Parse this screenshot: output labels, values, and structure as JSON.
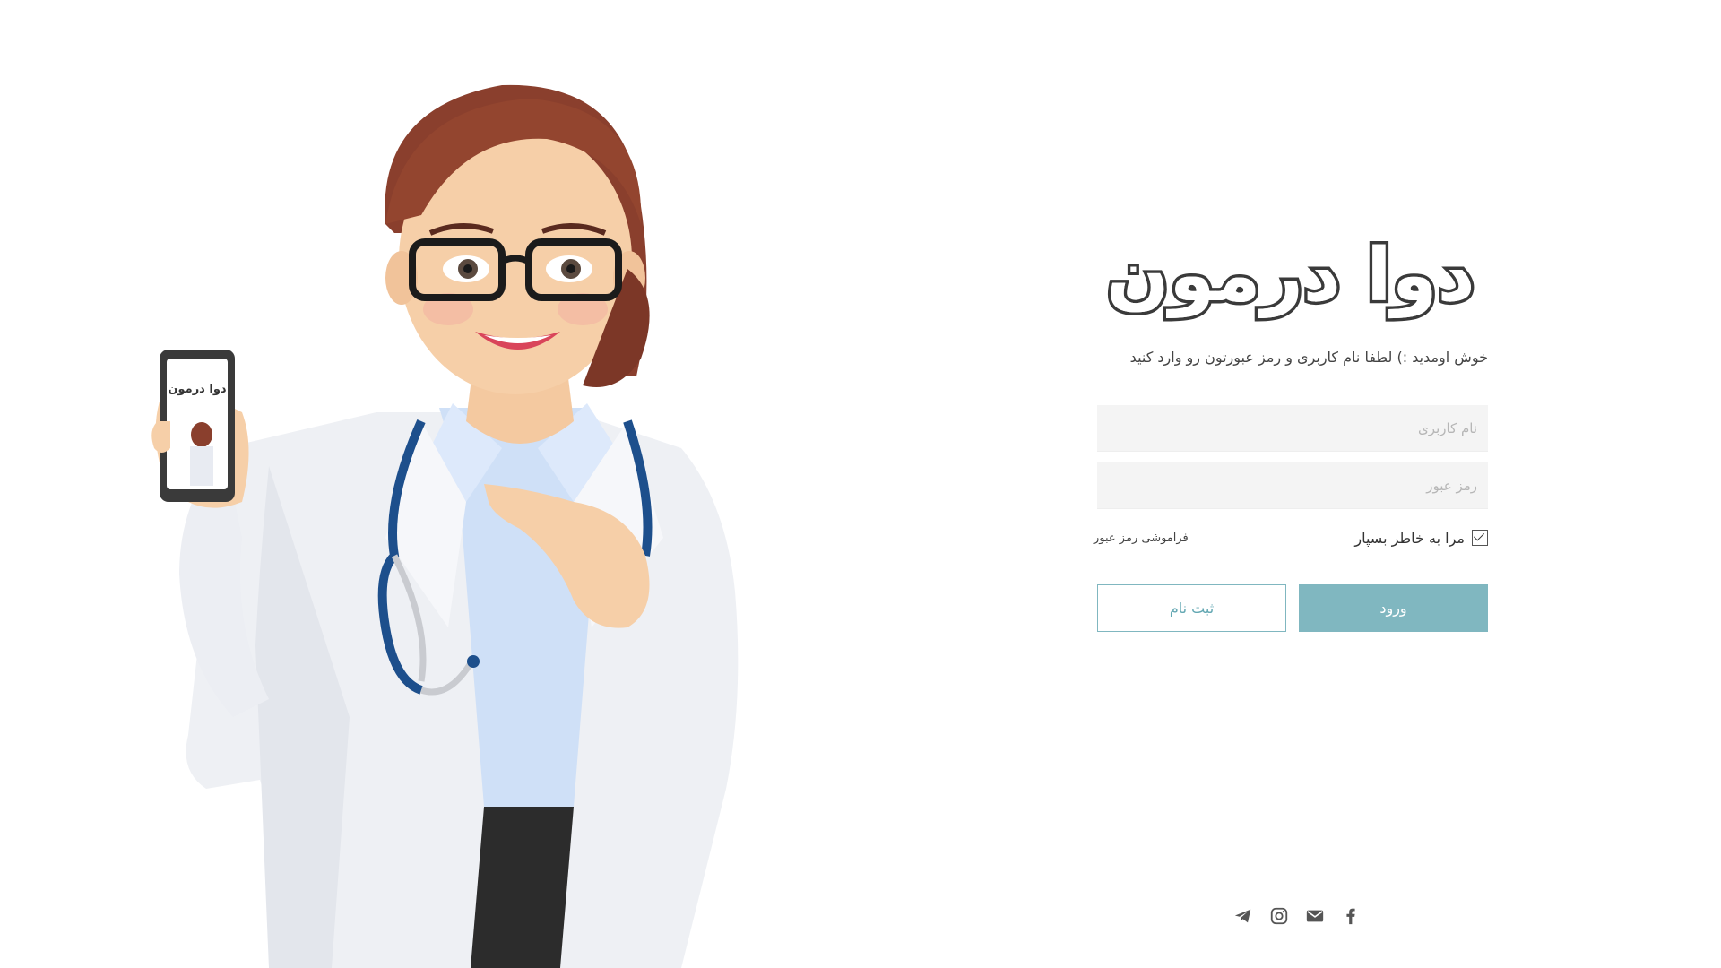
{
  "brand": {
    "logo_text": "دوا درمون"
  },
  "login": {
    "welcome": "خوش اومدید :) لطفا نام کاربری و رمز عبورتون رو وارد کنید",
    "username_placeholder": "نام کاربری",
    "username_value": "",
    "password_placeholder": "رمز عبور",
    "password_value": "",
    "remember_label": "مرا به خاطر بسپار",
    "remember_checked": true,
    "forgot_label": "فراموشی رمز عبور",
    "login_label": "ورود",
    "register_label": "ثبت نام"
  },
  "social": [
    "telegram-icon",
    "instagram-icon",
    "mail-icon",
    "facebook-icon"
  ],
  "colors": {
    "primary": "#80b7c0",
    "field_bg": "#f4f4f4"
  }
}
